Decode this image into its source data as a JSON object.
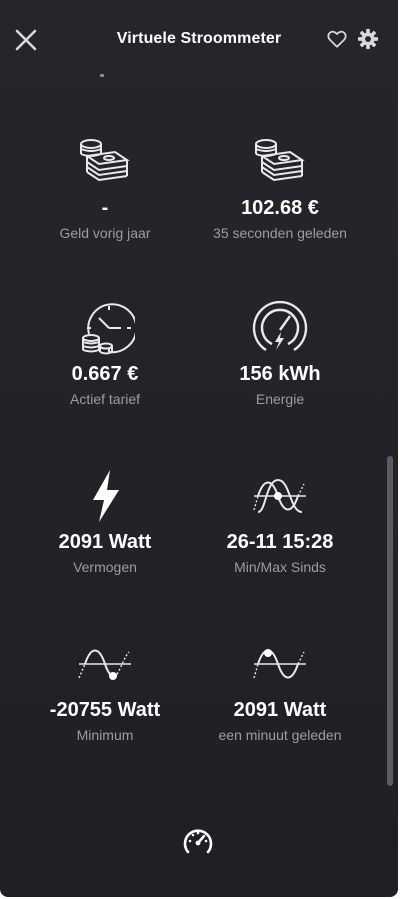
{
  "header": {
    "title": "Virtuele Stroommeter",
    "close_icon": "close-icon",
    "favorite_icon": "heart-icon",
    "settings_icon": "gear-icon"
  },
  "tiles": [
    {
      "icon": "money-stack-icon",
      "value": "-",
      "label": "Geld vorig jaar"
    },
    {
      "icon": "money-stack-icon",
      "value": "102.68 €",
      "label": "35 seconden geleden"
    },
    {
      "icon": "clock-coins-icon",
      "value": "0.667 €",
      "label": "Actief tarief"
    },
    {
      "icon": "energy-gauge-icon",
      "value": "156 kWh",
      "label": "Energie"
    },
    {
      "icon": "lightning-icon",
      "value": "2091 Watt",
      "label": "Vermogen"
    },
    {
      "icon": "sine-wave-max-icon",
      "value": "26-11 15:28",
      "label": "Min/Max Sinds"
    },
    {
      "icon": "sine-wave-min-icon",
      "value": "-20755 Watt",
      "label": "Minimum"
    },
    {
      "icon": "sine-wave-max-icon",
      "value": "2091 Watt",
      "label": "een minuut geleden"
    }
  ],
  "footer": {
    "icon": "speedometer-icon"
  },
  "colors": {
    "background": "#222327",
    "text": "#ffffff",
    "label": "#9c9da2"
  }
}
